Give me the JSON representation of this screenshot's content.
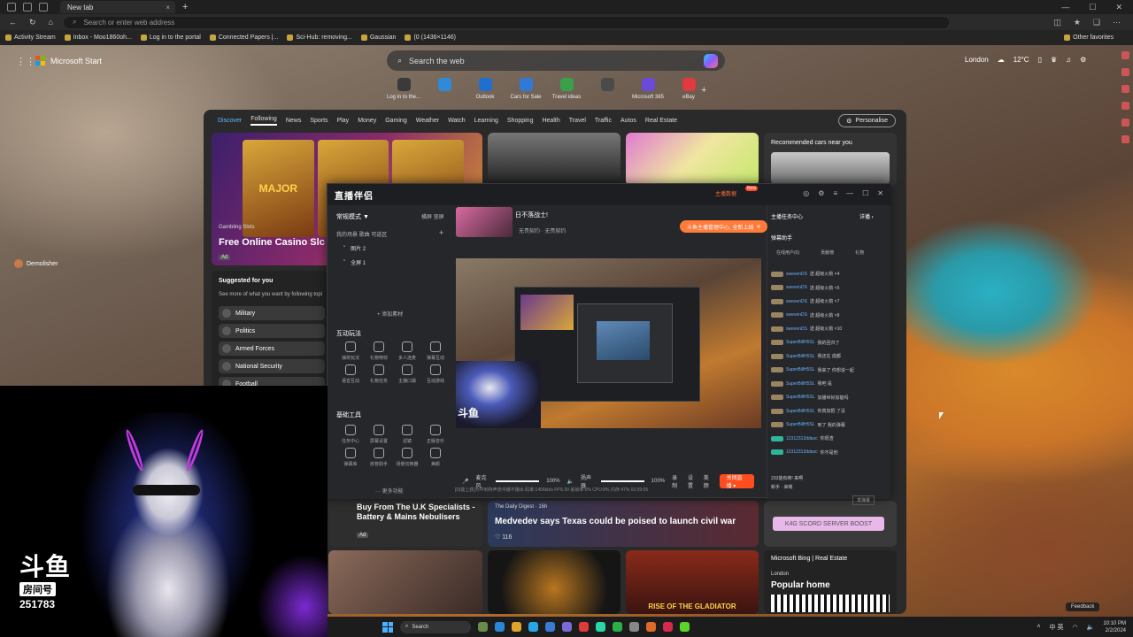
{
  "browser": {
    "tab_title": "New tab",
    "address_placeholder": "Search or enter web address",
    "favorites": [
      "Activity Stream",
      "Inbox - Moo1860oh...",
      "Log in to the portal",
      "Connected Papers |...",
      "Sci-Hub: removing...",
      "Gaussian",
      "Other favorites"
    ],
    "window_size_label": "(0 (1436×1146)"
  },
  "start": {
    "brand": "Microsoft Start",
    "search_placeholder": "Search the web",
    "weather": {
      "city": "London",
      "temp": "12°C"
    },
    "shortcuts": [
      {
        "label": "Log in to the...",
        "color": "#3a3a3a"
      },
      {
        "label": "",
        "color": "#2f8ad8"
      },
      {
        "label": "Outlook",
        "color": "#1f6fd0"
      },
      {
        "label": "Cars for Sale",
        "color": "#2f7ad8"
      },
      {
        "label": "Travel ideas",
        "color": "#3aa04a"
      },
      {
        "label": "",
        "color": "#4a4a4a"
      },
      {
        "label": "Microsoft 365",
        "color": "#6a4ad8"
      },
      {
        "label": "eBay",
        "color": "#e0393e"
      }
    ],
    "nav": [
      "Discover",
      "Following",
      "News",
      "Sports",
      "Play",
      "Money",
      "Gaming",
      "Weather",
      "Watch",
      "Learning",
      "Shopping",
      "Health",
      "Travel",
      "Traffic",
      "Autos",
      "Real Estate"
    ],
    "personalise": "Personalise",
    "casino": {
      "source": "Gambling Slots",
      "title": "Free Online Casino Slc",
      "ad": "Ad",
      "tiles": [
        "MAJOR",
        "",
        "MAJOR"
      ]
    },
    "cars_card": "Recommended cars near you",
    "suggested": {
      "title": "Suggested for you",
      "sub": "See more of what you want by following topi",
      "topics": [
        "Military",
        "Politics",
        "Armed Forces",
        "National Security",
        "Football"
      ]
    },
    "demolisher": "Demolisher",
    "ad_card": {
      "title": "Buy From The U.K Specialists - Battery & Mains Nebulisers",
      "ad": "Ad"
    },
    "news_card": {
      "source": "The Daily Digest · 16h",
      "title": "Medvedev says Texas could be poised to launch civil war",
      "likes": "116"
    },
    "boost_card": "K4G  SCORD SERVER BOOST",
    "slots_card": "RISE OF THE GLADIATOR",
    "bing": {
      "header": "Microsoft Bing | Real Estate",
      "city": "London",
      "title": "Popular home"
    }
  },
  "streamer": {
    "logo": "直播伴侣",
    "top_btn": "主播数据",
    "hot": "New",
    "mode": "常规模式 ▼",
    "mode_tabs": "横屏  竖屏",
    "scene_tabs": "我的场景  歌曲  可选区",
    "sources": [
      "图片 2",
      "全屏 1"
    ],
    "add_source": "+ 添加素材",
    "interact_title": "互动玩法",
    "interact_tools": [
      "抽奖玩法",
      "礼物特效",
      "多人连麦",
      "弹幕互动",
      "语音互动",
      "礼物任务",
      "主播口袋",
      "互动游戏"
    ],
    "basic_title": "基础工具",
    "basic_tools": [
      "任务中心",
      "屏幕设置",
      "滤镜",
      "正版音乐",
      "弹幕库",
      "房管助手",
      "场景切换器",
      "美颜"
    ],
    "more": "··· 更多功能",
    "preview_title": "日不落战士!",
    "preview_sub": "无畏契约 · 无畏契约",
    "toast": "斗鱼主播管理中心, 全新上线",
    "controls": {
      "mic": "麦克风",
      "mic_pct": "100%",
      "speaker": "扬声器",
      "spk_pct": "100%",
      "record": "录制",
      "settings": "设置",
      "beauty": "美颜",
      "close": "关闭直播 ▾"
    },
    "status": "[D]能上获]为中到存声流中播不播出   码率:1456kb/s  FPS:30  丢帧率:0%  CPU:8%  内存:47%  02:39:05",
    "right_head": "主播任务中心",
    "right_head2": "详播 ›",
    "helper": "弹幕助手",
    "right_tabs": [
      "在线用户(0)",
      "贡献榜",
      "礼物"
    ],
    "chat": [
      {
        "user": "swevenDS",
        "text": "送 超级火箭 ×4",
        "g": false
      },
      {
        "user": "swevenDS",
        "text": "送 超级火箭 ×5",
        "g": false
      },
      {
        "user": "swevenDS",
        "text": "送 超级火箭 ×7",
        "g": false
      },
      {
        "user": "swevenDS",
        "text": "送 超级火箭 ×8",
        "g": false
      },
      {
        "user": "swevenDS",
        "text": "送 超级火箭 ×10",
        "g": false
      },
      {
        "user": "SuperBillH5SL",
        "text": "我的回归了",
        "g": false
      },
      {
        "user": "SuperBillH5SL",
        "text": "我还在 成都",
        "g": false
      },
      {
        "user": "SuperBillH5SL",
        "text": "我来了 你想说一起",
        "g": false
      },
      {
        "user": "SuperBillH5SL",
        "text": "我吧 是",
        "g": false
      },
      {
        "user": "SuperBillH5SL",
        "text": "加播世好加能吗",
        "g": false
      },
      {
        "user": "SuperBillH5SL",
        "text": "你真加把 了没",
        "g": false
      },
      {
        "user": "SuperBillH5SL",
        "text": "到了 我的弹幕",
        "g": false
      },
      {
        "user": "12312312ddaxc",
        "text": "你很渣",
        "g": true
      },
      {
        "user": "12312312ddaxc",
        "text": "你不是他",
        "g": true
      }
    ],
    "chat_foot1": "233能有绑! 来啊",
    "chat_foot2": "新手 · 来嗯",
    "send": "发弹幕"
  },
  "overlay": {
    "logo": "斗鱼",
    "label": "房间号",
    "room": "251783"
  },
  "taskbar": {
    "search": "Search",
    "time": "10:10 PM",
    "date": "2/2/2024",
    "ime": "中 英"
  },
  "feedback": "Feedback"
}
